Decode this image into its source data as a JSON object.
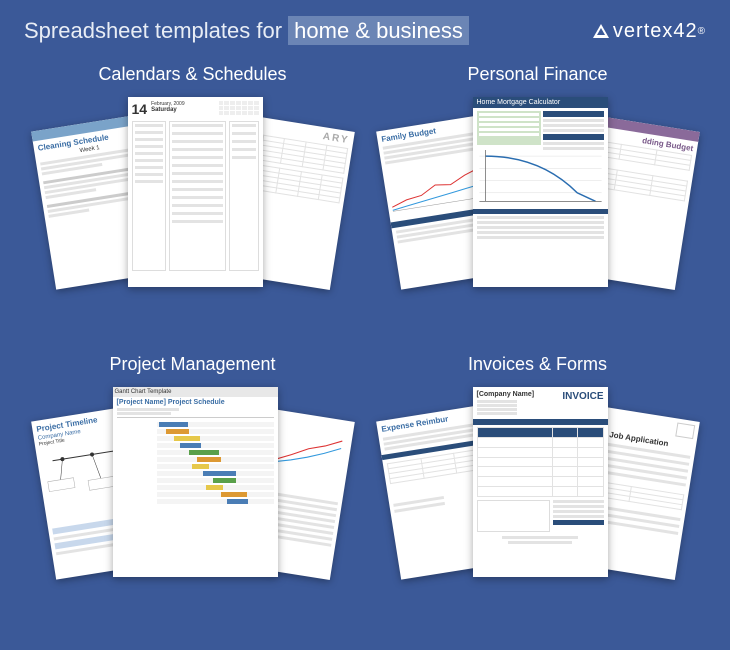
{
  "header": {
    "headline_prefix": "Spreadsheet templates for ",
    "headline_highlight": "home & business",
    "brand": "vertex42",
    "brand_reg": "®"
  },
  "categories": [
    {
      "title": "Calendars & Schedules",
      "sheets": {
        "left": {
          "title": "Cleaning Schedule",
          "sub": "Week 1"
        },
        "mid": {
          "day": "14",
          "month": "February, 2009",
          "dow": "Saturday"
        },
        "right": {
          "title": "ARY"
        }
      }
    },
    {
      "title": "Personal Finance",
      "sheets": {
        "left": {
          "title": "Family Budget"
        },
        "mid": {
          "title": "Home Mortgage Calculator"
        },
        "right": {
          "title": "dding Budget"
        }
      }
    },
    {
      "title": "Project Management",
      "sheets": {
        "left": {
          "title": "Project Timeline",
          "sub": "Company Name",
          "sub2": "Project Title"
        },
        "mid": {
          "title": "Gantt Chart Template",
          "sub": "[Project Name] Project Schedule"
        },
        "right": {
          "title": ""
        }
      }
    },
    {
      "title": "Invoices & Forms",
      "sheets": {
        "left": {
          "title": "Expense Reimbur"
        },
        "mid": {
          "title": "INVOICE",
          "sub": "[Company Name]"
        },
        "right": {
          "title": "Job Application"
        }
      }
    }
  ]
}
